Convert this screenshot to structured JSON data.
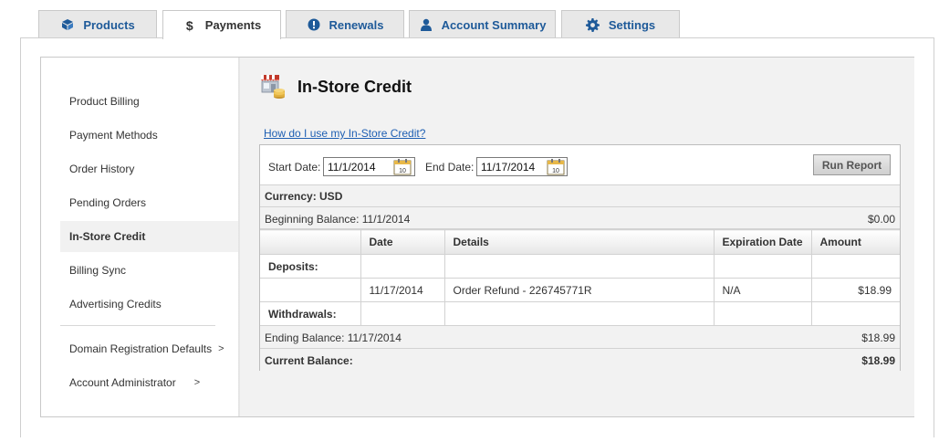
{
  "tabs": [
    {
      "label": "Products",
      "icon": "cube-icon"
    },
    {
      "label": "Payments",
      "icon": "dollar-icon"
    },
    {
      "label": "Renewals",
      "icon": "alert-icon"
    },
    {
      "label": "Account Summary",
      "icon": "user-icon"
    },
    {
      "label": "Settings",
      "icon": "gear-icon"
    }
  ],
  "sidebar": {
    "items": [
      {
        "label": "Product Billing"
      },
      {
        "label": "Payment Methods"
      },
      {
        "label": "Order History"
      },
      {
        "label": "Pending Orders"
      },
      {
        "label": "In-Store Credit"
      },
      {
        "label": "Billing Sync"
      },
      {
        "label": "Advertising Credits"
      }
    ],
    "sub_items": [
      {
        "label": "Domain Registration Defaults",
        "chevron": ">"
      },
      {
        "label": "Account Administrator",
        "chevron": ">"
      }
    ]
  },
  "page": {
    "title": "In-Store Credit",
    "help_link": "How do I use my In-Store Credit?"
  },
  "filter": {
    "start_label": "Start Date:",
    "start_value": "11/1/2014",
    "end_label": "End Date:",
    "end_value": "11/17/2014",
    "calendar_day": "10",
    "run_button": "Run Report"
  },
  "report": {
    "currency": "Currency: USD",
    "beginning_label": "Beginning Balance: 11/1/2014",
    "beginning_amount": "$0.00",
    "columns": [
      "",
      "Date",
      "Details",
      "Expiration Date",
      "Amount"
    ],
    "deposits_label": "Deposits:",
    "deposit_rows": [
      {
        "date": "11/17/2014",
        "details": "Order Refund - 226745771R",
        "expiration": "N/A",
        "amount": "$18.99"
      }
    ],
    "withdrawals_label": "Withdrawals:",
    "ending_label": "Ending Balance: 11/17/2014",
    "ending_amount": "$18.99",
    "current_label": "Current Balance:",
    "current_amount": "$18.99"
  },
  "colors": {
    "link": "#1e5fb3",
    "tab_text": "#1e5a99",
    "positive_amount": "#4a8a2a"
  }
}
